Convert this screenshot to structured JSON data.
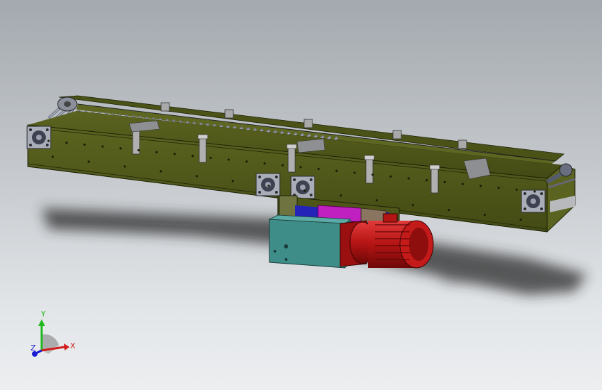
{
  "viewport": {
    "background_top": "#a4a9af",
    "background_bottom": "#eceef0"
  },
  "model": {
    "frame_color": "#4e5518",
    "roller_color": "#8a8f9e",
    "motor_color": "#c01818",
    "gearbox_color": "#3c8a86",
    "bracket_color": "#a9a9a9",
    "plate_color": "#c020c0"
  },
  "triad": {
    "x_label": "X",
    "y_label": "Y",
    "z_label": "Z",
    "x_color": "#d21a1a",
    "y_color": "#1fb81f",
    "z_color": "#1a1ad2"
  }
}
